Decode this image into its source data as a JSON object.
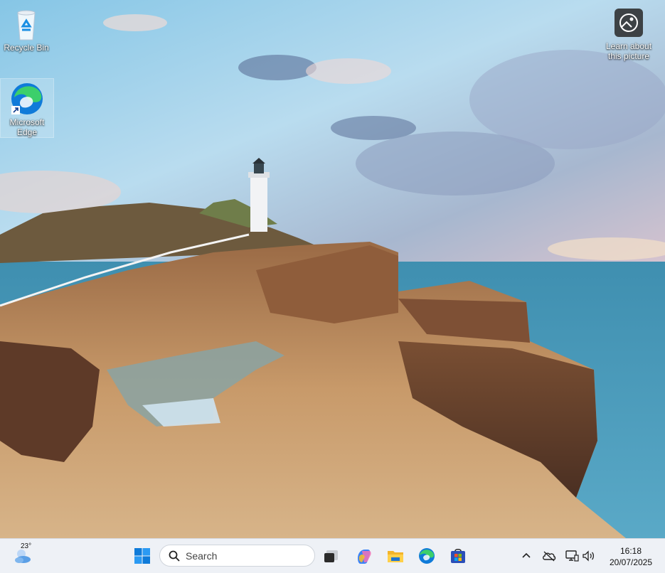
{
  "desktop": {
    "icons": [
      {
        "label": "Recycle Bin",
        "icon": "recycle-bin-icon"
      },
      {
        "label": "Microsoft\nEdge",
        "icon": "edge-icon"
      },
      {
        "label": "Learn about\nthis picture",
        "icon": "learn-picture-icon"
      }
    ]
  },
  "taskbar": {
    "weather": {
      "temp": "23°",
      "icon": "weather-partly-cloudy-icon"
    },
    "start_icon": "windows-start-icon",
    "search": {
      "placeholder": "Search",
      "icon": "search-icon"
    },
    "pinned": [
      {
        "name": "Task View",
        "icon": "task-view-icon"
      },
      {
        "name": "Copilot",
        "icon": "copilot-icon"
      },
      {
        "name": "File Explorer",
        "icon": "folder-icon"
      },
      {
        "name": "Microsoft Edge",
        "icon": "edge-icon"
      },
      {
        "name": "Microsoft Store",
        "icon": "store-icon"
      }
    ],
    "tray": {
      "icons": [
        "chevron-up-icon",
        "onedrive-offline-icon",
        "network-icon",
        "volume-icon"
      ],
      "time": "16:18",
      "date": "20/07/2025"
    }
  },
  "colors": {
    "taskbar_bg": "#eef1f6",
    "accent_blue": "#0078d4"
  }
}
